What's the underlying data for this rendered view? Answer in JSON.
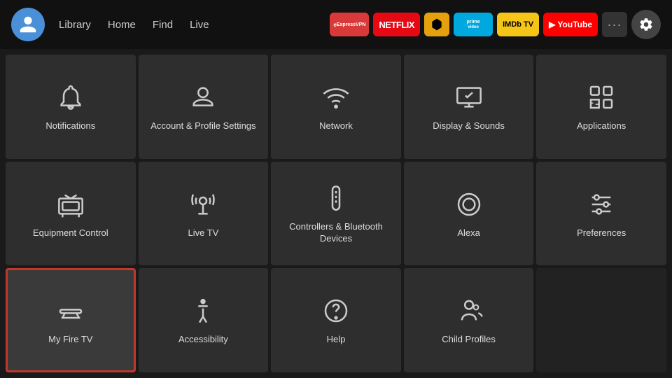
{
  "nav": {
    "links": [
      "Library",
      "Home",
      "Find",
      "Live"
    ],
    "apps": [
      {
        "id": "expressvpn",
        "label": "ExpressVPN",
        "class": "badge-expressvpn"
      },
      {
        "id": "netflix",
        "label": "NETFLIX",
        "class": "badge-netflix"
      },
      {
        "id": "plex",
        "label": "►",
        "class": "badge-plex"
      },
      {
        "id": "prime",
        "label": "prime video",
        "class": "badge-prime"
      },
      {
        "id": "imdb",
        "label": "IMDb TV",
        "class": "badge-imdb"
      },
      {
        "id": "youtube",
        "label": "▶ YouTube",
        "class": "badge-youtube"
      }
    ],
    "more_label": "···",
    "settings_label": "Settings"
  },
  "grid": {
    "items": [
      {
        "id": "notifications",
        "label": "Notifications",
        "icon": "bell"
      },
      {
        "id": "account",
        "label": "Account & Profile Settings",
        "icon": "person"
      },
      {
        "id": "network",
        "label": "Network",
        "icon": "wifi"
      },
      {
        "id": "display-sounds",
        "label": "Display & Sounds",
        "icon": "display"
      },
      {
        "id": "applications",
        "label": "Applications",
        "icon": "apps"
      },
      {
        "id": "equipment-control",
        "label": "Equipment Control",
        "icon": "tv"
      },
      {
        "id": "live-tv",
        "label": "Live TV",
        "icon": "antenna"
      },
      {
        "id": "controllers",
        "label": "Controllers & Bluetooth Devices",
        "icon": "remote"
      },
      {
        "id": "alexa",
        "label": "Alexa",
        "icon": "alexa"
      },
      {
        "id": "preferences",
        "label": "Preferences",
        "icon": "sliders"
      },
      {
        "id": "my-fire-tv",
        "label": "My Fire TV",
        "icon": "firetv",
        "selected": true
      },
      {
        "id": "accessibility",
        "label": "Accessibility",
        "icon": "accessibility"
      },
      {
        "id": "help",
        "label": "Help",
        "icon": "help"
      },
      {
        "id": "child-profiles",
        "label": "Child Profiles",
        "icon": "child"
      },
      {
        "id": "empty",
        "label": "",
        "icon": "none"
      }
    ]
  }
}
